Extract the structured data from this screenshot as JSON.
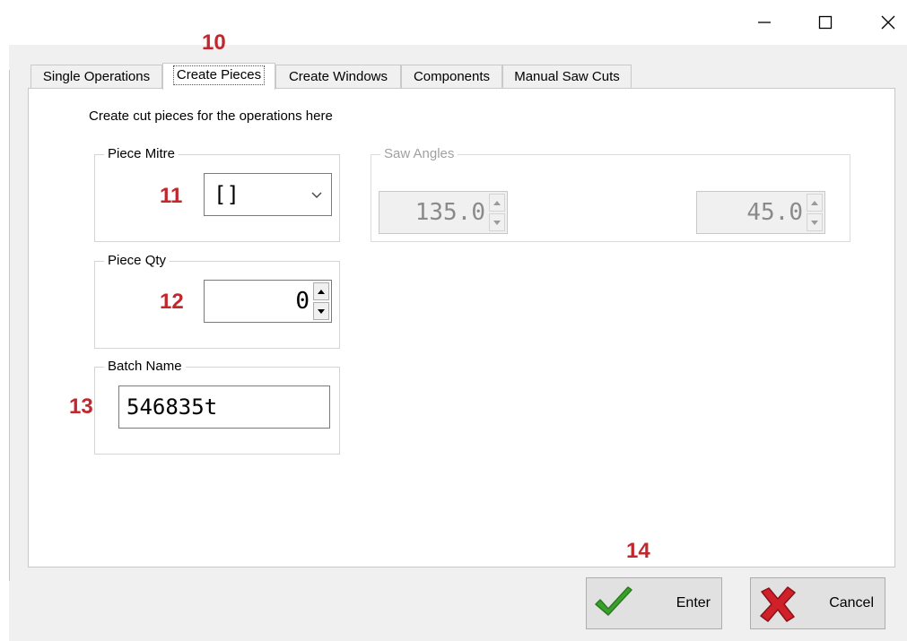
{
  "markers": {
    "tab": "10",
    "mitre": "11",
    "qty": "12",
    "batch": "13",
    "enter": "14"
  },
  "tabs": [
    {
      "label": "Single Operations"
    },
    {
      "label": "Create Pieces"
    },
    {
      "label": "Create Windows"
    },
    {
      "label": "Components"
    },
    {
      "label": "Manual Saw Cuts"
    }
  ],
  "panel": {
    "intro": "Create cut pieces for the operations here",
    "piece_mitre": {
      "label": "Piece Mitre",
      "value": "[]"
    },
    "saw_angles": {
      "label": "Saw Angles",
      "left_value": "135.0",
      "right_value": "45.0"
    },
    "piece_qty": {
      "label": "Piece Qty",
      "value": "0"
    },
    "batch_name": {
      "label": "Batch Name",
      "value": "546835t"
    }
  },
  "buttons": {
    "enter": "Enter",
    "cancel": "Cancel"
  },
  "colors": {
    "marker": "#c0282d",
    "check": "#3aa02c",
    "cross": "#d0202a",
    "dialog_bg": "#f0f0f0"
  },
  "icons": {
    "minimize": "minimize-icon",
    "maximize": "maximize-icon",
    "close": "close-icon",
    "chevron": "chevron-down-icon",
    "enter": "check-icon",
    "cancel": "cross-icon"
  }
}
